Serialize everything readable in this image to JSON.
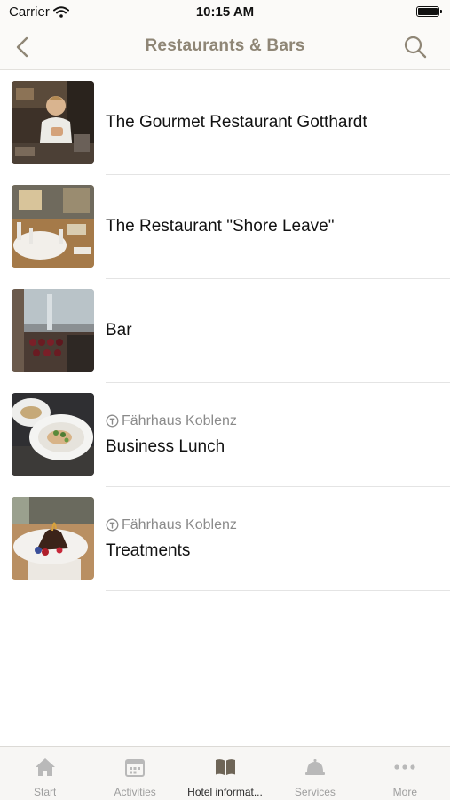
{
  "status_bar": {
    "carrier": "Carrier",
    "time": "10:15 AM"
  },
  "nav": {
    "title": "Restaurants & Bars",
    "back_icon": "chevron-left-icon",
    "search_icon": "search-icon"
  },
  "colors": {
    "accent": "#8f8676",
    "tab_active": "#6e6557",
    "tab_inactive": "#b9b9b9"
  },
  "items": [
    {
      "subtitle": "",
      "title": "The Gourmet Restaurant Gotthardt"
    },
    {
      "subtitle": "",
      "title": "The Restaurant \"Shore Leave\""
    },
    {
      "subtitle": "",
      "title": "Bar"
    },
    {
      "subtitle": "Fährhaus Koblenz",
      "title": "Business Lunch"
    },
    {
      "subtitle": "Fährhaus Koblenz",
      "title": "Treatments"
    }
  ],
  "tabs": [
    {
      "label": "Start",
      "icon": "home-icon",
      "active": false
    },
    {
      "label": "Activities",
      "icon": "calendar-icon",
      "active": false
    },
    {
      "label": "Hotel informat...",
      "icon": "book-icon",
      "active": true
    },
    {
      "label": "Services",
      "icon": "service-bell-icon",
      "active": false
    },
    {
      "label": "More",
      "icon": "more-dots-icon",
      "active": false
    }
  ]
}
